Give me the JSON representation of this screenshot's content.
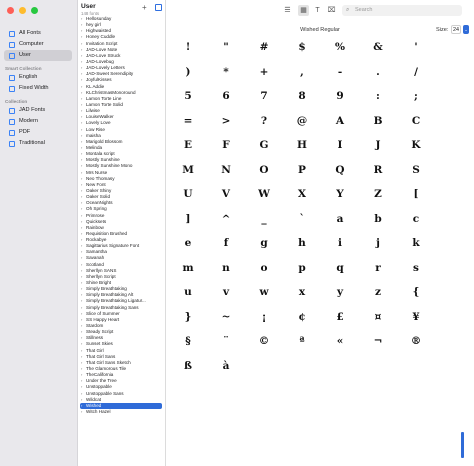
{
  "sidebar": {
    "items": [
      {
        "label": "All Fonts",
        "icon": "font-book-icon"
      },
      {
        "label": "Computer",
        "icon": "computer-icon"
      },
      {
        "label": "User",
        "icon": "user-icon",
        "selected": true
      }
    ],
    "smart_collection": {
      "heading": "Smart Collection",
      "items": [
        {
          "label": "English",
          "icon": "globe-icon"
        },
        {
          "label": "Fixed Width",
          "icon": "fixed-width-icon"
        }
      ]
    },
    "collection": {
      "heading": "Collection",
      "items": [
        {
          "label": "JAD Fonts",
          "icon": "collection-icon"
        },
        {
          "label": "Modern",
          "icon": "collection-icon"
        },
        {
          "label": "PDF",
          "icon": "collection-icon"
        },
        {
          "label": "Traditional",
          "icon": "collection-icon"
        }
      ]
    }
  },
  "list": {
    "title": "User",
    "subtitle": "148 fonts",
    "fonts": [
      "Hellosunday",
      "hey girl",
      "Highwaisted",
      "Honey Cuddle",
      "Invitation Script",
      "JAD-Love Note",
      "JAD-Love Struck",
      "JAD-Lovebug",
      "JAD-Lovely Letters",
      "JAD-Sweet Serendipity",
      "JoyfulKisses",
      "KL Addie",
      "KLChristmasMonoround",
      "Lamon Torte Line",
      "Lamon Torte Solid",
      "Lilwise",
      "LouiseWalker",
      "Lovely Love",
      "Low Rise",
      "maisha",
      "Marigold Blossom",
      "Melinda",
      "Montala script",
      "Mostly Sunshine",
      "Mostly Sunshine Mono",
      "Mrs Nurse",
      "Neo Thomasy",
      "New Font",
      "Oaker Shiny",
      "Oaker Solid",
      "OceanNights",
      "Oh Spring",
      "Primrose",
      "Quicksets",
      "Rainbow",
      "Requisition Brushed",
      "Rockabye",
      "Sagittarius Signature Font",
      "Samantha",
      "Savanah",
      "Scotland",
      "Sherllyn SANS",
      "Sherllyn Script",
      "Shine Bright",
      "Simply Breathtaking",
      "Simply Breathtaking Alt",
      "Simply Breathtaking Ligatur...",
      "Simply Breathtaking Sans",
      "Slice of Summer",
      "SS Happy Heart",
      "Stardom",
      "Steady Script",
      "Stillness",
      "Sunset Skies",
      "That Girl",
      "That Girl Sans",
      "That Girl Sans Sketch",
      "The Glamorous Tile",
      "TheCalifornia",
      "Under the Tree",
      "Unstoppable",
      "Unstoppable Sans",
      "Wildcat",
      "Wished",
      "Witch Hazel"
    ],
    "selected": "Wished"
  },
  "toolbar": {
    "search_placeholder": "Search"
  },
  "preview": {
    "font_name": "Wished Regular",
    "size_label": "Size:",
    "size_value": "24",
    "glyph_rows": [
      [
        "!",
        "\"",
        "#",
        "$",
        "%",
        "&",
        "'"
      ],
      [
        ")",
        "*",
        "+",
        ",",
        "-",
        ".",
        "/"
      ],
      [
        "5",
        "6",
        "7",
        "8",
        "9",
        ":",
        ";"
      ],
      [
        "=",
        ">",
        "?",
        "@",
        "A",
        "B",
        "C"
      ],
      [
        "E",
        "F",
        "G",
        "H",
        "I",
        "J",
        "K"
      ],
      [
        "M",
        "N",
        "O",
        "P",
        "Q",
        "R",
        "S"
      ],
      [
        "U",
        "V",
        "W",
        "X",
        "Y",
        "Z",
        "["
      ],
      [
        "]",
        "^",
        "_",
        "`",
        "a",
        "b",
        "c"
      ],
      [
        "e",
        "f",
        "g",
        "h",
        "i",
        "j",
        "k"
      ],
      [
        "m",
        "n",
        "o",
        "p",
        "q",
        "r",
        "s"
      ],
      [
        "u",
        "v",
        "w",
        "x",
        "y",
        "z",
        "{"
      ],
      [
        "}",
        "~",
        "¡",
        "¢",
        "£",
        "¤",
        "¥"
      ],
      [
        "§",
        "¨",
        "©",
        "ª",
        "«",
        "¬",
        "®"
      ]
    ],
    "glyph_rows_extra": [
      [
        "ß",
        "à",
        "",
        "",
        "",
        "",
        ""
      ]
    ]
  }
}
